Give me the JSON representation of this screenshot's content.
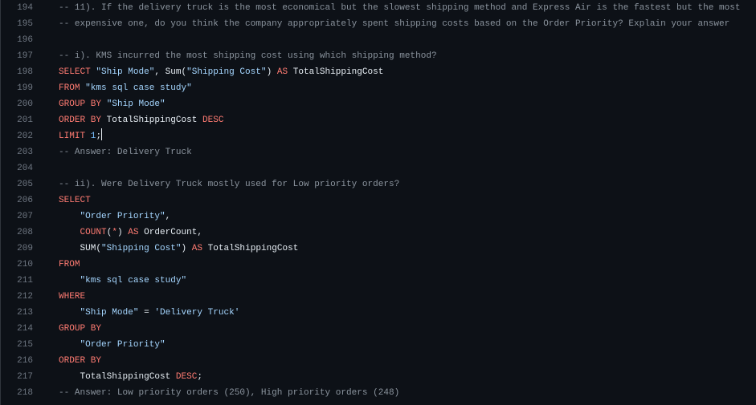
{
  "editor": {
    "lines": [
      {
        "num": "194",
        "tokens": [
          {
            "t": "-- 11). If the delivery truck is the most economical but the slowest shipping method and Express Air is the fastest but the most",
            "c": "c"
          }
        ]
      },
      {
        "num": "195",
        "tokens": [
          {
            "t": "-- expensive one, do you think the company appropriately spent shipping costs based on the Order Priority? Explain your answer",
            "c": "c"
          }
        ]
      },
      {
        "num": "196",
        "tokens": []
      },
      {
        "num": "197",
        "tokens": [
          {
            "t": "-- i). KMS incurred the most shipping cost using which shipping method?",
            "c": "c"
          }
        ]
      },
      {
        "num": "198",
        "tokens": [
          {
            "t": "SELECT",
            "c": "k"
          },
          {
            "t": " ",
            "c": "i"
          },
          {
            "t": "\"Ship Mode\"",
            "c": "s"
          },
          {
            "t": ", Sum(",
            "c": "i"
          },
          {
            "t": "\"Shipping Cost\"",
            "c": "s"
          },
          {
            "t": ") ",
            "c": "i"
          },
          {
            "t": "AS",
            "c": "k"
          },
          {
            "t": " TotalShippingCost",
            "c": "i"
          }
        ]
      },
      {
        "num": "199",
        "tokens": [
          {
            "t": "FROM",
            "c": "k"
          },
          {
            "t": " ",
            "c": "i"
          },
          {
            "t": "\"kms sql case study\"",
            "c": "s"
          }
        ]
      },
      {
        "num": "200",
        "tokens": [
          {
            "t": "GROUP BY",
            "c": "k"
          },
          {
            "t": " ",
            "c": "i"
          },
          {
            "t": "\"Ship Mode\"",
            "c": "s"
          }
        ]
      },
      {
        "num": "201",
        "tokens": [
          {
            "t": "ORDER BY",
            "c": "k"
          },
          {
            "t": " TotalShippingCost ",
            "c": "i"
          },
          {
            "t": "DESC",
            "c": "k"
          }
        ]
      },
      {
        "num": "202",
        "tokens": [
          {
            "t": "LIMIT",
            "c": "k"
          },
          {
            "t": " ",
            "c": "i"
          },
          {
            "t": "1",
            "c": "n"
          },
          {
            "t": ";",
            "c": "i"
          }
        ],
        "cursor": true
      },
      {
        "num": "203",
        "tokens": [
          {
            "t": "-- Answer: Delivery Truck",
            "c": "c"
          }
        ]
      },
      {
        "num": "204",
        "tokens": []
      },
      {
        "num": "205",
        "tokens": [
          {
            "t": "-- ii). Were Delivery Truck mostly used for Low priority orders?",
            "c": "c"
          }
        ]
      },
      {
        "num": "206",
        "tokens": [
          {
            "t": "SELECT",
            "c": "k"
          }
        ]
      },
      {
        "num": "207",
        "tokens": [
          {
            "t": "    ",
            "c": "i"
          },
          {
            "t": "\"Order Priority\"",
            "c": "s"
          },
          {
            "t": ",",
            "c": "i"
          }
        ]
      },
      {
        "num": "208",
        "tokens": [
          {
            "t": "    ",
            "c": "i"
          },
          {
            "t": "COUNT",
            "c": "k"
          },
          {
            "t": "(",
            "c": "i"
          },
          {
            "t": "*",
            "c": "k"
          },
          {
            "t": ") ",
            "c": "i"
          },
          {
            "t": "AS",
            "c": "k"
          },
          {
            "t": " OrderCount,",
            "c": "i"
          }
        ]
      },
      {
        "num": "209",
        "tokens": [
          {
            "t": "    SUM(",
            "c": "i"
          },
          {
            "t": "\"Shipping Cost\"",
            "c": "s"
          },
          {
            "t": ") ",
            "c": "i"
          },
          {
            "t": "AS",
            "c": "k"
          },
          {
            "t": " TotalShippingCost",
            "c": "i"
          }
        ]
      },
      {
        "num": "210",
        "tokens": [
          {
            "t": "FROM",
            "c": "k"
          }
        ]
      },
      {
        "num": "211",
        "tokens": [
          {
            "t": "    ",
            "c": "i"
          },
          {
            "t": "\"kms sql case study\"",
            "c": "s"
          }
        ]
      },
      {
        "num": "212",
        "tokens": [
          {
            "t": "WHERE",
            "c": "k"
          }
        ]
      },
      {
        "num": "213",
        "tokens": [
          {
            "t": "    ",
            "c": "i"
          },
          {
            "t": "\"Ship Mode\"",
            "c": "s"
          },
          {
            "t": " = ",
            "c": "i"
          },
          {
            "t": "'Delivery Truck'",
            "c": "s"
          }
        ]
      },
      {
        "num": "214",
        "tokens": [
          {
            "t": "GROUP BY",
            "c": "k"
          }
        ]
      },
      {
        "num": "215",
        "tokens": [
          {
            "t": "    ",
            "c": "i"
          },
          {
            "t": "\"Order Priority\"",
            "c": "s"
          }
        ]
      },
      {
        "num": "216",
        "tokens": [
          {
            "t": "ORDER BY",
            "c": "k"
          }
        ]
      },
      {
        "num": "217",
        "tokens": [
          {
            "t": "    TotalShippingCost ",
            "c": "i"
          },
          {
            "t": "DESC",
            "c": "k"
          },
          {
            "t": ";",
            "c": "i"
          }
        ]
      },
      {
        "num": "218",
        "tokens": [
          {
            "t": "-- Answer: Low priority orders (250), High priority orders (248)",
            "c": "c"
          }
        ]
      }
    ]
  }
}
